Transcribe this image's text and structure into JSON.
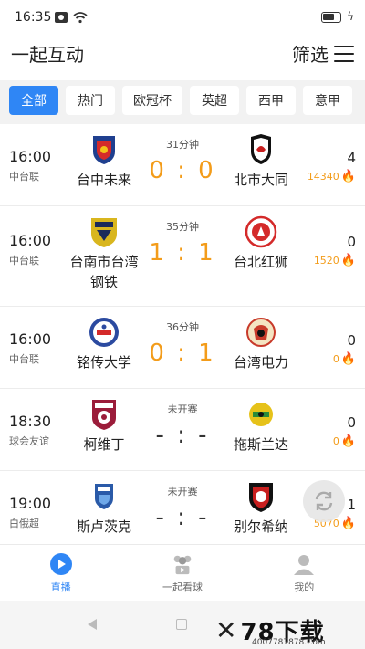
{
  "status_bar": {
    "time": "16:35"
  },
  "header": {
    "title": "一起互动",
    "filter_label": "筛选"
  },
  "tabs": [
    {
      "label": "全部",
      "active": true
    },
    {
      "label": "热门",
      "active": false
    },
    {
      "label": "欧冠杯",
      "active": false
    },
    {
      "label": "英超",
      "active": false
    },
    {
      "label": "西甲",
      "active": false
    },
    {
      "label": "意甲",
      "active": false
    }
  ],
  "matches": [
    {
      "time": "16:00",
      "league": "中台联",
      "status": "31分钟",
      "score": "0 : 0",
      "home": "台中未来",
      "away": "北市大同",
      "count": "4",
      "heat": "14340",
      "home_color": "#1f3f8f",
      "away_color": "#111111"
    },
    {
      "time": "16:00",
      "league": "中台联",
      "status": "35分钟",
      "score": "1 : 1",
      "home": "台南市台湾钢铁",
      "away": "台北红狮",
      "count": "0",
      "heat": "1520",
      "home_color": "#d9b61e",
      "away_color": "#d42a2a"
    },
    {
      "time": "16:00",
      "league": "中台联",
      "status": "36分钟",
      "score": "0 : 1",
      "home": "铭传大学",
      "away": "台湾电力",
      "count": "0",
      "heat": "0",
      "home_color": "#2b4aa0",
      "away_color": "#c83a2a"
    },
    {
      "time": "18:30",
      "league": "球会友谊",
      "status": "未开赛",
      "score": "- : -",
      "home": "柯维丁",
      "away": "拖斯兰达",
      "count": "0",
      "heat": "0",
      "home_color": "#9b1c3a",
      "away_color": "#e6c21a"
    },
    {
      "time": "19:00",
      "league": "白俄超",
      "status": "未开赛",
      "score": "- : -",
      "home": "斯卢茨克",
      "away": "别尔希纳",
      "count": "1",
      "heat": "5070",
      "home_color": "#2a5aa8",
      "away_color": "#c81f1f"
    }
  ],
  "bottom_nav": [
    {
      "label": "直播",
      "active": true
    },
    {
      "label": "一起看球",
      "active": false
    },
    {
      "label": "我的",
      "active": false
    }
  ],
  "watermark": {
    "text": "78下载",
    "url": "4007787878.Com"
  }
}
